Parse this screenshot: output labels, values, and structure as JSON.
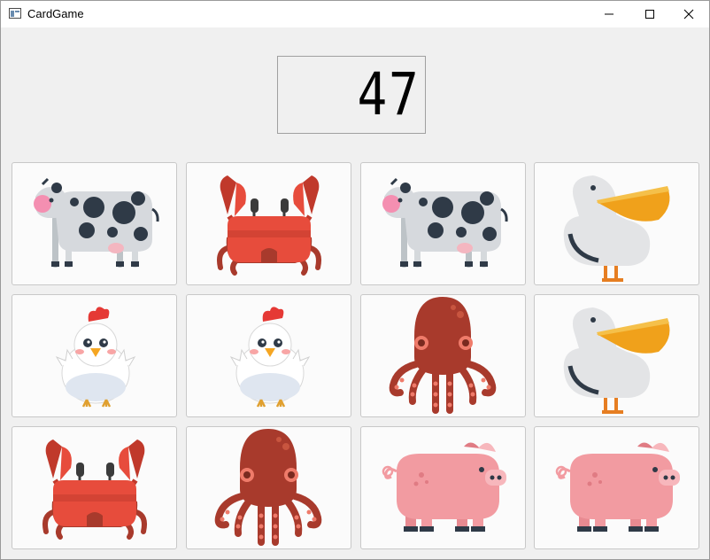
{
  "window": {
    "title": "CardGame",
    "controls": [
      "minimize-icon",
      "maximize-icon",
      "close-icon"
    ]
  },
  "counter": {
    "value": "47"
  },
  "cards": [
    {
      "animal": "cow"
    },
    {
      "animal": "crab"
    },
    {
      "animal": "cow"
    },
    {
      "animal": "pelican"
    },
    {
      "animal": "chicken"
    },
    {
      "animal": "chicken"
    },
    {
      "animal": "octopus"
    },
    {
      "animal": "pelican"
    },
    {
      "animal": "crab"
    },
    {
      "animal": "octopus"
    },
    {
      "animal": "pig"
    },
    {
      "animal": "pig"
    }
  ],
  "colors": {
    "cow_spot": "#2f3a47",
    "crab": "#e74c3c",
    "octopus": "#a83a2c",
    "pig": "#f29ba1",
    "pelican_beak": "#f0a11b"
  }
}
